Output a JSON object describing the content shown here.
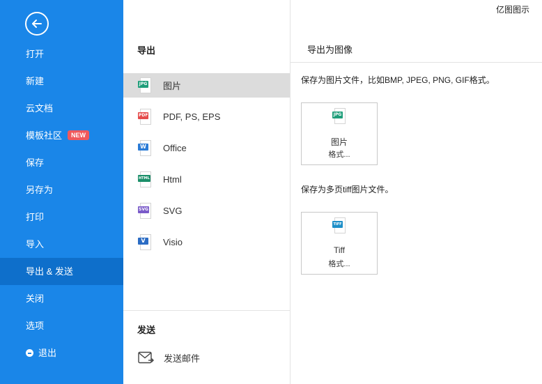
{
  "app": {
    "brand": "亿图图示"
  },
  "sidebar": {
    "back_icon": "arrow-left-circle-icon",
    "items": [
      {
        "label": "打开"
      },
      {
        "label": "新建"
      },
      {
        "label": "云文档"
      },
      {
        "label": "模板社区",
        "badge": "NEW"
      },
      {
        "label": "保存"
      },
      {
        "label": "另存为"
      },
      {
        "label": "打印"
      },
      {
        "label": "导入"
      },
      {
        "label": "导出 & 发送",
        "active": true
      },
      {
        "label": "关闭"
      },
      {
        "label": "选项"
      },
      {
        "label": "退出",
        "icon": "minus-circle-icon"
      }
    ]
  },
  "export_panel": {
    "title": "导出",
    "items": [
      {
        "label": "图片",
        "icon_text": "JPG",
        "color": "#1f9e7a",
        "active": true
      },
      {
        "label": "PDF, PS, EPS",
        "icon_text": "PDF",
        "color": "#e54b4b"
      },
      {
        "label": "Office",
        "icon_text": "W",
        "color": "#2b7bd6"
      },
      {
        "label": "Html",
        "icon_text": "HTML",
        "color": "#1c8f6a"
      },
      {
        "label": "SVG",
        "icon_text": "SVG",
        "color": "#7a5bc9"
      },
      {
        "label": "Visio",
        "icon_text": "V",
        "color": "#2b6cc4"
      }
    ]
  },
  "send_panel": {
    "title": "发送",
    "mail_label": "发送邮件",
    "mail_icon": "envelope-icon"
  },
  "detail": {
    "title": "导出为图像",
    "image_desc": "保存为图片文件，比如BMP, JPEG, PNG, GIF格式。",
    "image_card": {
      "icon_text": "JPG",
      "line1": "图片",
      "line2": "格式..."
    },
    "tiff_desc": "保存为多页tiff图片文件。",
    "tiff_card": {
      "icon_text": "TIFF",
      "line1": "Tiff",
      "line2": "格式..."
    }
  },
  "colors": {
    "sidebar": "#1a86e8",
    "sidebar_active": "#0e6fcb",
    "badge": "#f0595c",
    "menu_active": "#dcdcdc",
    "jpg": "#1f9e7a",
    "tiff": "#1e8fc8"
  }
}
